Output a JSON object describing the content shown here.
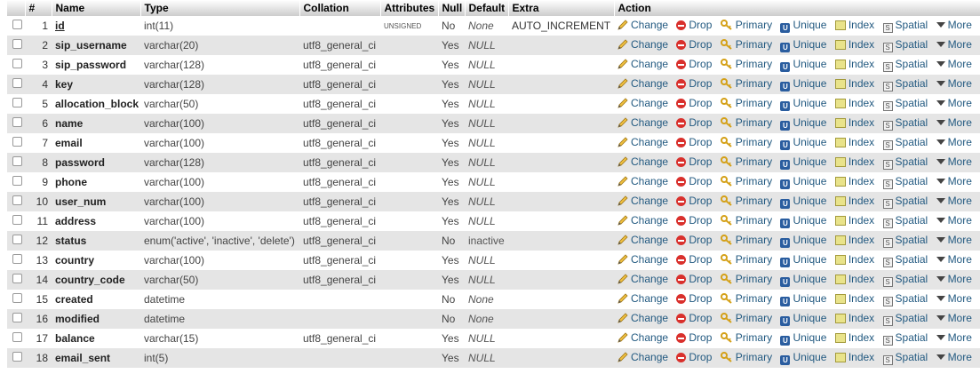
{
  "headers": [
    "#",
    "Name",
    "Type",
    "Collation",
    "Attributes",
    "Null",
    "Default",
    "Extra",
    "Action"
  ],
  "actions": {
    "change": "Change",
    "drop": "Drop",
    "primary": "Primary",
    "unique": "Unique",
    "index": "Index",
    "spatial": "Spatial",
    "more": "More",
    "unique_glyph": "U",
    "spatial_glyph": "S"
  },
  "rows": [
    {
      "num": "1",
      "name": "id",
      "type": "int(11)",
      "collation": "",
      "attributes": "UNSIGNED",
      "null": "No",
      "default": "None",
      "extra": "AUTO_INCREMENT"
    },
    {
      "num": "2",
      "name": "sip_username",
      "type": "varchar(20)",
      "collation": "utf8_general_ci",
      "attributes": "",
      "null": "Yes",
      "default": "NULL",
      "extra": ""
    },
    {
      "num": "3",
      "name": "sip_password",
      "type": "varchar(128)",
      "collation": "utf8_general_ci",
      "attributes": "",
      "null": "Yes",
      "default": "NULL",
      "extra": ""
    },
    {
      "num": "4",
      "name": "key",
      "type": "varchar(128)",
      "collation": "utf8_general_ci",
      "attributes": "",
      "null": "Yes",
      "default": "NULL",
      "extra": ""
    },
    {
      "num": "5",
      "name": "allocation_block",
      "type": "varchar(50)",
      "collation": "utf8_general_ci",
      "attributes": "",
      "null": "Yes",
      "default": "NULL",
      "extra": ""
    },
    {
      "num": "6",
      "name": "name",
      "type": "varchar(100)",
      "collation": "utf8_general_ci",
      "attributes": "",
      "null": "Yes",
      "default": "NULL",
      "extra": ""
    },
    {
      "num": "7",
      "name": "email",
      "type": "varchar(100)",
      "collation": "utf8_general_ci",
      "attributes": "",
      "null": "Yes",
      "default": "NULL",
      "extra": ""
    },
    {
      "num": "8",
      "name": "password",
      "type": "varchar(128)",
      "collation": "utf8_general_ci",
      "attributes": "",
      "null": "Yes",
      "default": "NULL",
      "extra": ""
    },
    {
      "num": "9",
      "name": "phone",
      "type": "varchar(100)",
      "collation": "utf8_general_ci",
      "attributes": "",
      "null": "Yes",
      "default": "NULL",
      "extra": ""
    },
    {
      "num": "10",
      "name": "user_num",
      "type": "varchar(100)",
      "collation": "utf8_general_ci",
      "attributes": "",
      "null": "Yes",
      "default": "NULL",
      "extra": ""
    },
    {
      "num": "11",
      "name": "address",
      "type": "varchar(100)",
      "collation": "utf8_general_ci",
      "attributes": "",
      "null": "Yes",
      "default": "NULL",
      "extra": ""
    },
    {
      "num": "12",
      "name": "status",
      "type": "enum('active', 'inactive', 'delete')",
      "collation": "utf8_general_ci",
      "attributes": "",
      "null": "No",
      "default": "inactive",
      "extra": ""
    },
    {
      "num": "13",
      "name": "country",
      "type": "varchar(100)",
      "collation": "utf8_general_ci",
      "attributes": "",
      "null": "Yes",
      "default": "NULL",
      "extra": ""
    },
    {
      "num": "14",
      "name": "country_code",
      "type": "varchar(50)",
      "collation": "utf8_general_ci",
      "attributes": "",
      "null": "Yes",
      "default": "NULL",
      "extra": ""
    },
    {
      "num": "15",
      "name": "created",
      "type": "datetime",
      "collation": "",
      "attributes": "",
      "null": "No",
      "default": "None",
      "extra": ""
    },
    {
      "num": "16",
      "name": "modified",
      "type": "datetime",
      "collation": "",
      "attributes": "",
      "null": "No",
      "default": "None",
      "extra": ""
    },
    {
      "num": "17",
      "name": "balance",
      "type": "varchar(15)",
      "collation": "utf8_general_ci",
      "attributes": "",
      "null": "Yes",
      "default": "NULL",
      "extra": ""
    },
    {
      "num": "18",
      "name": "email_sent",
      "type": "int(5)",
      "collation": "",
      "attributes": "",
      "null": "Yes",
      "default": "NULL",
      "extra": ""
    }
  ]
}
